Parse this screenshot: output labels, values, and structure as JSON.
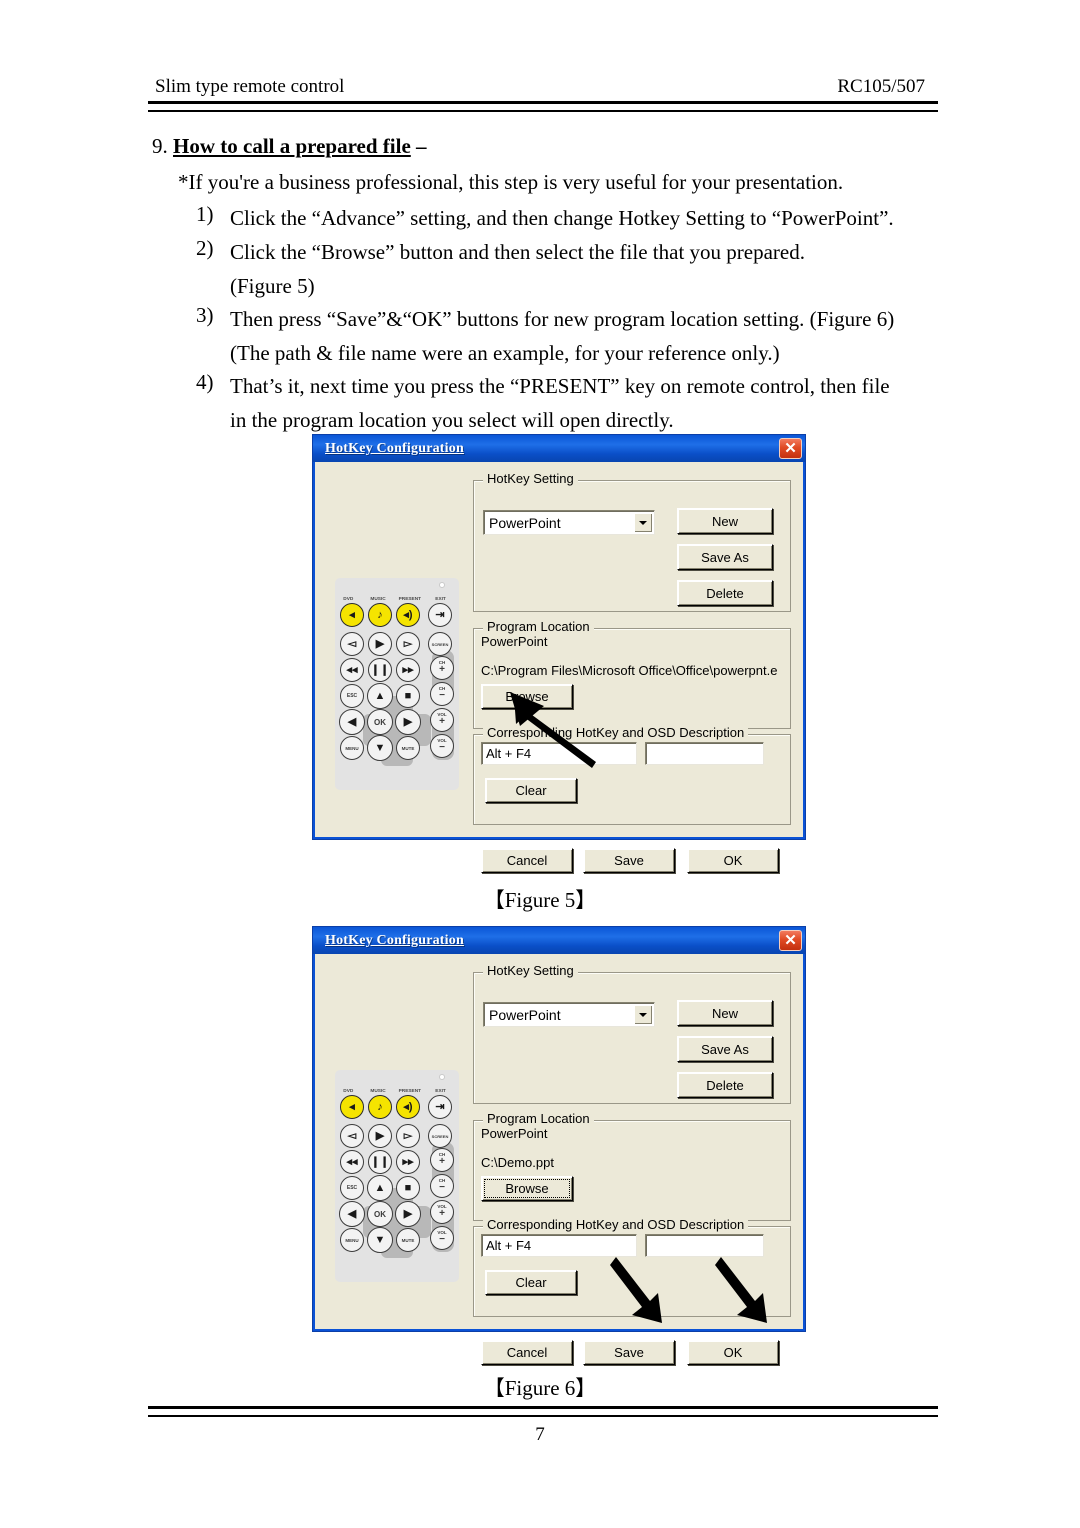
{
  "header": {
    "left": "Slim type remote control",
    "right": "RC105/507"
  },
  "section": {
    "number": "9.",
    "title": "How to call a prepared file",
    "dash": "–",
    "note": "*If you're a business professional, this step is very useful for your presentation.",
    "items": [
      {
        "marker": "1)",
        "text": "Click the “Advance” setting, and then change Hotkey Setting to “PowerPoint”.",
        "cont": ""
      },
      {
        "marker": "2)",
        "text": "Click the “Browse” button and then select the file that you prepared.",
        "cont": "(Figure 5)"
      },
      {
        "marker": "3)",
        "text": "Then press “Save”&“OK” buttons for new program location setting. (Figure 6)",
        "cont": "(The path & file name were an example, for your reference only.)"
      },
      {
        "marker": "4)",
        "text": "That’s it, next time you press the “PRESENT” key on remote control, then file",
        "cont": "in the program location you select will open directly."
      }
    ]
  },
  "figure5": {
    "caption": "【Figure 5】",
    "dialog": {
      "title": "HotKey Configuration",
      "close_label": "✕",
      "hotkey_group_label": "HotKey Setting",
      "combo_value": "PowerPoint",
      "btn_new": "New",
      "btn_save_as": "Save As",
      "btn_delete": "Delete",
      "program_group_label": "Program Location",
      "program_name": "PowerPoint",
      "program_path": "C:\\Program Files\\Microsoft Office\\Office\\powerpnt.exe",
      "btn_browse": "Browse",
      "osd_group_label": "Corresponding HotKey and OSD Description",
      "hotkey_value": "Alt + F4",
      "osd_value": "",
      "btn_clear": "Clear",
      "btn_cancel": "Cancel",
      "btn_save": "Save",
      "btn_ok": "OK"
    }
  },
  "figure6": {
    "caption": "【Figure 6】",
    "dialog": {
      "title": "HotKey Configuration",
      "close_label": "✕",
      "hotkey_group_label": "HotKey Setting",
      "combo_value": "PowerPoint",
      "btn_new": "New",
      "btn_save_as": "Save As",
      "btn_delete": "Delete",
      "program_group_label": "Program Location",
      "program_name": "PowerPoint",
      "program_path": "C:\\Demo.ppt",
      "btn_browse": "Browse",
      "osd_group_label": "Corresponding HotKey and OSD Description",
      "hotkey_value": "Alt + F4",
      "osd_value": "",
      "btn_clear": "Clear",
      "btn_cancel": "Cancel",
      "btn_save": "Save",
      "btn_ok": "OK"
    }
  },
  "remote": {
    "top_labels": [
      "DVD",
      "MUSIC",
      "PRESENT",
      "EXIT"
    ],
    "keys": [
      [
        "DVD",
        "MUSIC",
        "PRESENT",
        "EXIT"
      ],
      [
        "PREV",
        "PLAY",
        "NEXT",
        "SCREEN"
      ],
      [
        "REWIND",
        "PAUSE",
        "FORWARD",
        "CH +"
      ],
      [
        "ESC",
        "UP",
        "STOP",
        "CH −"
      ],
      [
        "LEFT",
        "OK",
        "RIGHT",
        "VOL +"
      ],
      [
        "MENU",
        "DOWN",
        "MUTE",
        "VOL −"
      ]
    ]
  },
  "footer": {
    "page_number": "7"
  },
  "colors": {
    "titlebar": "#0a52d6",
    "dialog_face": "#ece9d8",
    "close_red": "#e04a24",
    "key_yellow": "#f5e400"
  }
}
